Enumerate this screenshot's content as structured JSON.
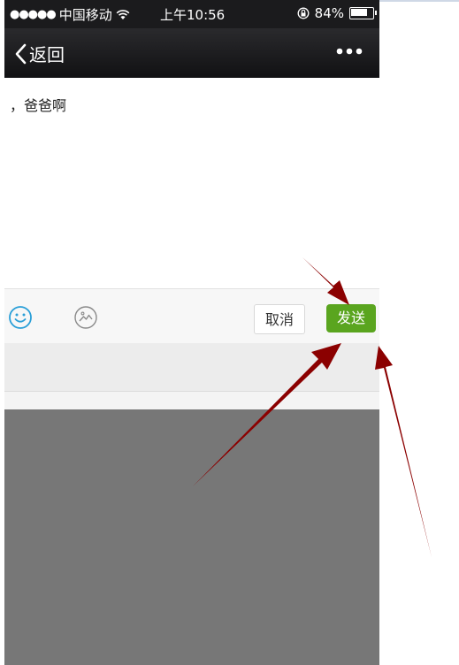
{
  "status_bar": {
    "signal_dots": "●●●●●",
    "carrier": "中国移动",
    "time": "上午10:56",
    "battery_percent": "84%",
    "battery_level": 0.84
  },
  "nav": {
    "back_label": "返回"
  },
  "message": {
    "text": "，爸爸啊"
  },
  "toolbar": {
    "cancel_label": "取消",
    "send_label": "发送"
  },
  "colors": {
    "send_button": "#5aa51f",
    "arrow": "#8b0000",
    "keyboard": "#777777"
  }
}
